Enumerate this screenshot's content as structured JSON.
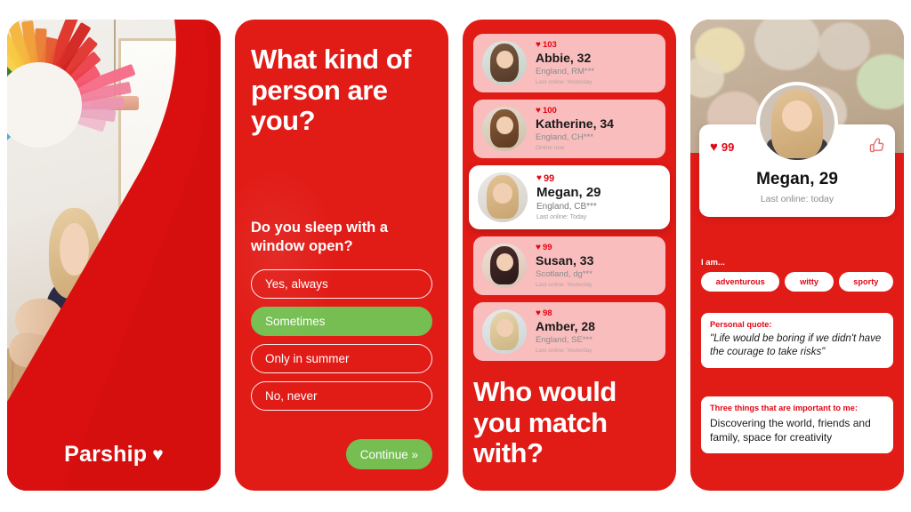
{
  "app": {
    "brand": "Parship",
    "brand_heart_icon": "heart-icon",
    "accent_red": "#E30613",
    "accent_green": "#76BE52",
    "card_pink": "#F9BDBD"
  },
  "panel1": {
    "name": "hero-panel",
    "logo_text": "Parship",
    "logo_heart": "♥"
  },
  "panel2": {
    "name": "quiz-panel",
    "headline": "What kind of person are you?",
    "question": "Do you sleep with a window open?",
    "options": [
      {
        "label": "Yes, always",
        "selected": false
      },
      {
        "label": "Sometimes",
        "selected": true
      },
      {
        "label": "Only in summer",
        "selected": false
      },
      {
        "label": "No, never",
        "selected": false
      }
    ],
    "continue_label": "Continue »"
  },
  "panel3": {
    "name": "match-list-panel",
    "headline": "Who would you match with?",
    "heart_icon": "♥",
    "matches": [
      {
        "score": "103",
        "name": "Abbie, 32",
        "location": "England, RM***",
        "online": "Last online: Yesterday",
        "active": false
      },
      {
        "score": "100",
        "name": "Katherine, 34",
        "location": "England, CH***",
        "online": "Online now",
        "active": false
      },
      {
        "score": "99",
        "name": "Megan, 29",
        "location": "England, CB***",
        "online": "Last online: Today",
        "active": true
      },
      {
        "score": "99",
        "name": "Susan, 33",
        "location": "Scotland, dg***",
        "online": "Last online: Yesterday",
        "active": false
      },
      {
        "score": "98",
        "name": "Amber, 28",
        "location": "England, SE***",
        "online": "Last online: Yesterday",
        "active": false
      }
    ]
  },
  "panel4": {
    "name": "Megan, 29",
    "score": "99",
    "heart_icon": "♥",
    "like_icon": "👍",
    "online": "Last online: today",
    "iam_label": "I am...",
    "tags": [
      "adventurous",
      "witty",
      "sporty"
    ],
    "quote_title": "Personal quote:",
    "quote_text": "\"Life would be boring if we didn't have the courage to take risks\"",
    "important_title": "Three things that are important to me:",
    "important_text": "Discovering the world, friends and family, space for creativity"
  }
}
